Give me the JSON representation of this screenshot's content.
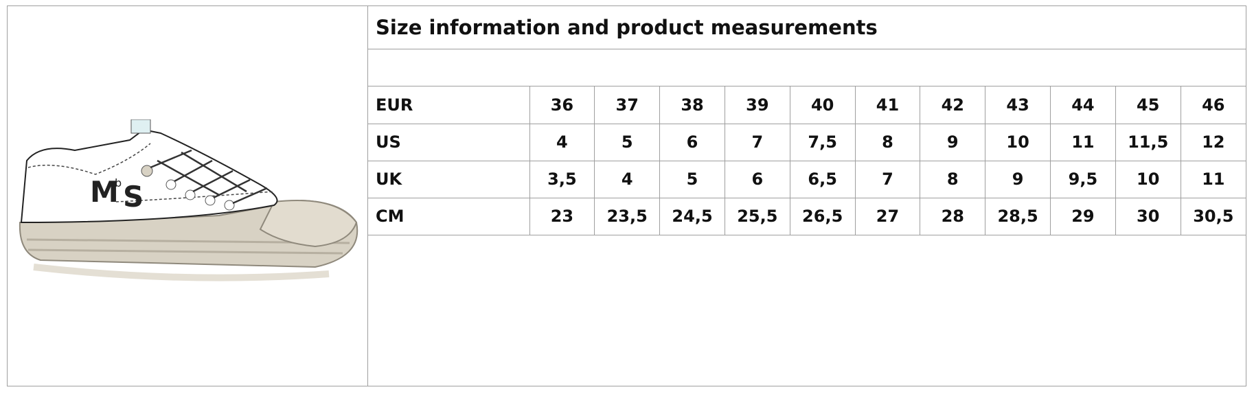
{
  "title": "Size information and product measurements",
  "logo_text": "MbS",
  "rows": [
    {
      "label": "EUR",
      "values": [
        "36",
        "37",
        "38",
        "39",
        "40",
        "41",
        "42",
        "43",
        "44",
        "45",
        "46"
      ]
    },
    {
      "label": "US",
      "values": [
        "4",
        "5",
        "6",
        "7",
        "7,5",
        "8",
        "9",
        "10",
        "11",
        "11,5",
        "12"
      ]
    },
    {
      "label": "UK",
      "values": [
        "3,5",
        "4",
        "5",
        "6",
        "6,5",
        "7",
        "8",
        "9",
        "9,5",
        "10",
        "11"
      ]
    },
    {
      "label": "CM",
      "values": [
        "23",
        "23,5",
        "24,5",
        "25,5",
        "26,5",
        "27",
        "28",
        "28,5",
        "29",
        "30",
        "30,5"
      ]
    }
  ]
}
